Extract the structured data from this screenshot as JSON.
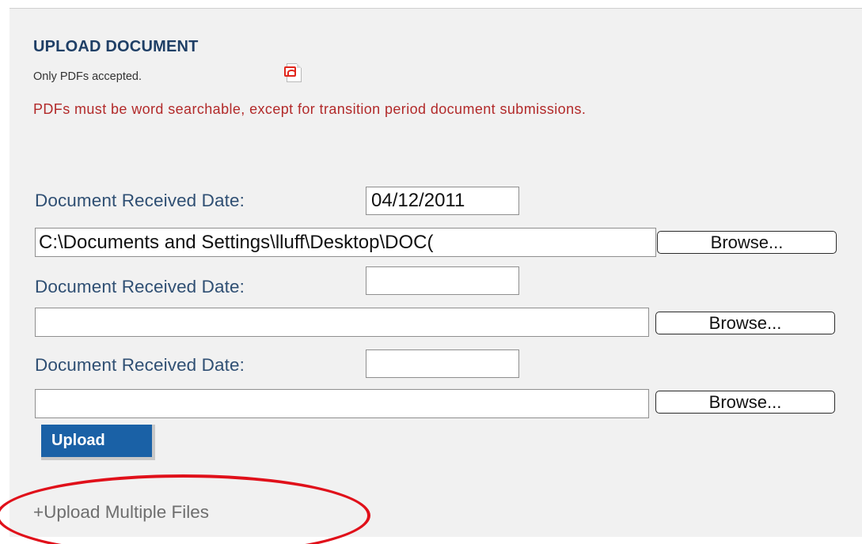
{
  "upload": {
    "heading": "UPLOAD DOCUMENT",
    "note": "Only PDFs accepted.",
    "pdf_icon": "pdf-file-icon",
    "warning": "PDFs must be word searchable, except for transition period document submissions.",
    "date_label": "Document Received Date:",
    "browse_label": "Browse...",
    "upload_label": "Upload",
    "multi_link": "+Upload Multiple Files",
    "rows": [
      {
        "date": "04/12/2011",
        "file": "C:\\Documents and Settings\\lluff\\Desktop\\DOC("
      },
      {
        "date": "",
        "file": ""
      },
      {
        "date": "",
        "file": ""
      }
    ]
  },
  "colors": {
    "heading": "#1f3f66",
    "warning": "#b22a2a",
    "upload_button": "#1a61a6",
    "highlight_ring": "#e0101a",
    "panel_background": "#f1f1f1"
  }
}
